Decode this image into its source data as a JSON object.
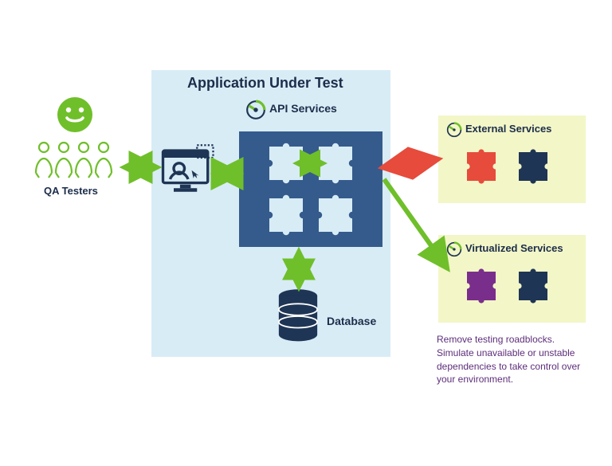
{
  "title": "Application Under Test",
  "labels": {
    "qa_testers": "QA Testers",
    "api_services": "API Services",
    "external_services": "External Services",
    "virtualized_services": "Virtualized Services",
    "database": "Database"
  },
  "caption": "Remove testing roadblocks. Simulate unavailable or unstable dependencies to take control over your environment.",
  "colors": {
    "green": "#6fbf2a",
    "dark": "#1f3555",
    "panel_blue": "#d8ecf6",
    "panel_yellow": "#f3f6c7",
    "api_bg": "#355b8c",
    "red": "#e64b3c",
    "purple": "#7a2e8c",
    "text_purple": "#5d2e7a"
  },
  "nodes": {
    "qa_testers": {
      "type": "people",
      "color": "green"
    },
    "client_ui": {
      "type": "monitor",
      "color": "dark"
    },
    "api_services": {
      "type": "puzzle-grid",
      "count": 4
    },
    "database": {
      "type": "cylinder",
      "color": "dark"
    },
    "external_services": {
      "pieces": [
        "red",
        "dark"
      ]
    },
    "virtualized_services": {
      "pieces": [
        "purple",
        "dark"
      ]
    }
  },
  "connectors": [
    {
      "from": "qa_testers",
      "to": "client_ui",
      "bidir": true,
      "color": "green"
    },
    {
      "from": "client_ui",
      "to": "api_services",
      "bidir": true,
      "color": "green"
    },
    {
      "from": "api_services",
      "to": "database",
      "bidir": true,
      "color": "green"
    },
    {
      "from": "api_services",
      "to": "external_services",
      "bidir": true,
      "color": "red"
    },
    {
      "from": "api_services",
      "to": "virtualized_services",
      "bidir": false,
      "color": "green"
    }
  ]
}
